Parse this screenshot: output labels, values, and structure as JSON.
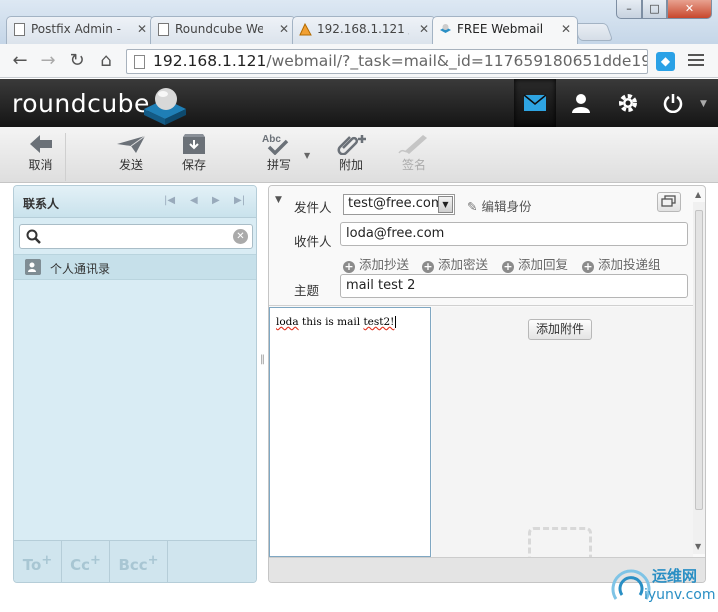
{
  "browser": {
    "tabs": [
      {
        "title": "Postfix Admin -",
        "active": false
      },
      {
        "title": "Roundcube We",
        "active": false
      },
      {
        "title": "192.168.1.121 /",
        "active": false
      },
      {
        "title": "FREE Webmail",
        "active": true
      }
    ],
    "address": {
      "host": "192.168.1.121",
      "path": "/webmail/?_task=mail&_id=117659180651dde19e;"
    },
    "window_controls": {
      "minimize": "–",
      "maximize": "□",
      "close": "✕"
    }
  },
  "header": {
    "logo": "roundcube",
    "nav_icons": [
      "mail-icon",
      "user-icon",
      "gear-icon",
      "power-icon"
    ]
  },
  "toolbar": {
    "cancel": "取消",
    "send": "发送",
    "save": "保存",
    "spell": "拼写",
    "attach": "附加",
    "signature": "签名"
  },
  "contacts": {
    "title": "联系人",
    "search_placeholder": "",
    "addressbook": "个人通讯录",
    "recipient_buttons": [
      "To",
      "Cc",
      "Bcc"
    ]
  },
  "compose": {
    "from_label": "发件人",
    "from_value": "test@free.com",
    "edit_identity": "编辑身份",
    "to_label": "收件人",
    "to_value": "loda@free.com",
    "add_cc": "添加抄送",
    "add_bcc": "添加密送",
    "add_reply": "添加回复",
    "add_followup": "添加投递组",
    "subject_label": "主题",
    "subject_value": "mail test 2",
    "body_word1": "loda",
    "body_rest": " this is mail ",
    "body_word2": "test2!",
    "attach_button": "添加附件"
  },
  "watermark": {
    "line1": "运维网",
    "line2": "iyunv.com"
  },
  "colors": {
    "header_bg": "#1e1e1e",
    "panel_blue": "#d9ecf4",
    "accent": "#2a8fc4"
  }
}
